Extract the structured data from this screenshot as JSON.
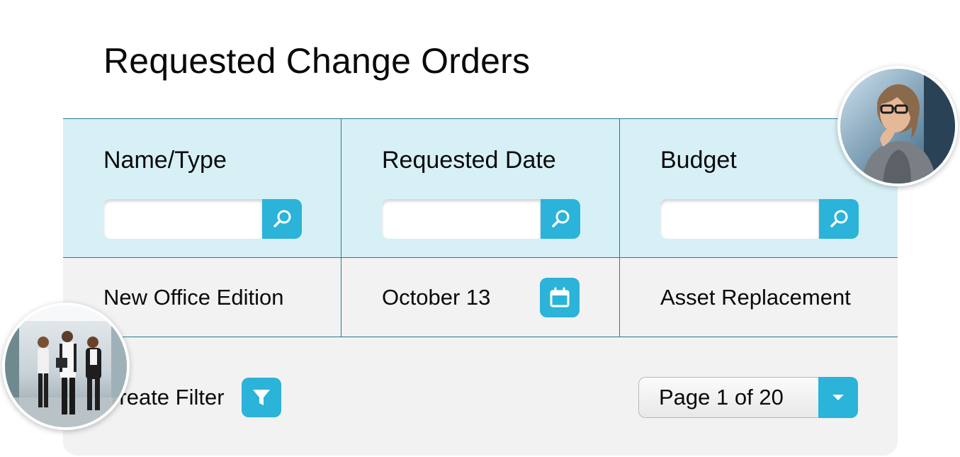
{
  "page": {
    "title": "Requested Change Orders"
  },
  "table": {
    "columns": [
      {
        "label": "Name/Type"
      },
      {
        "label": "Requested Date"
      },
      {
        "label": "Budget"
      }
    ],
    "row": {
      "name": "New Office Edition",
      "date": "October 13",
      "budget": "Asset Replacement"
    }
  },
  "footer": {
    "filter_label": "Create Filter",
    "pager_value": "Page 1 of 20"
  },
  "icons": {
    "search": "search-icon",
    "calendar": "calendar-icon",
    "filter": "filter-icon",
    "dropdown": "chevron-down-icon"
  },
  "colors": {
    "accent": "#2bb3d9",
    "header_bg": "#d6f0f6",
    "grid_line": "#2b7a95",
    "card_bg": "#f2f2f2"
  }
}
